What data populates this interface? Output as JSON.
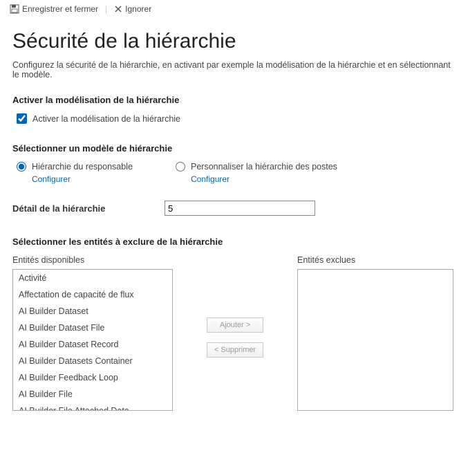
{
  "toolbar": {
    "save_close_label": "Enregistrer et fermer",
    "ignore_label": "Ignorer"
  },
  "page": {
    "title": "Sécurité de la hiérarchie",
    "description": "Configurez la sécurité de la hiérarchie, en activant par exemple la modélisation de la hiérarchie et en sélectionnant le modèle."
  },
  "enable_section": {
    "header": "Activer la modélisation de la hiérarchie",
    "checkbox_label": "Activer la modélisation de la hiérarchie",
    "checked": true
  },
  "model_section": {
    "header": "Sélectionner un modèle de hiérarchie",
    "manager": {
      "label": "Hiérarchie du responsable",
      "configure": "Configurer"
    },
    "position": {
      "label": "Personnaliser la hiérarchie des postes",
      "configure": "Configurer"
    }
  },
  "depth": {
    "label": "Détail de la hiérarchie",
    "value": "5"
  },
  "exclude_section": {
    "header": "Sélectionner les entités à exclure de la hiérarchie",
    "available_label": "Entités disponibles",
    "excluded_label": "Entités exclues",
    "add_button": "Ajouter >",
    "remove_button": "< Supprimer",
    "available_items": [
      "Activité",
      "Affectation de capacité de flux",
      "AI Builder Dataset",
      "AI Builder Dataset File",
      "AI Builder Dataset Record",
      "AI Builder Datasets Container",
      "AI Builder Feedback Loop",
      "AI Builder File",
      "AI Builder File Attached Data"
    ],
    "excluded_items": []
  }
}
